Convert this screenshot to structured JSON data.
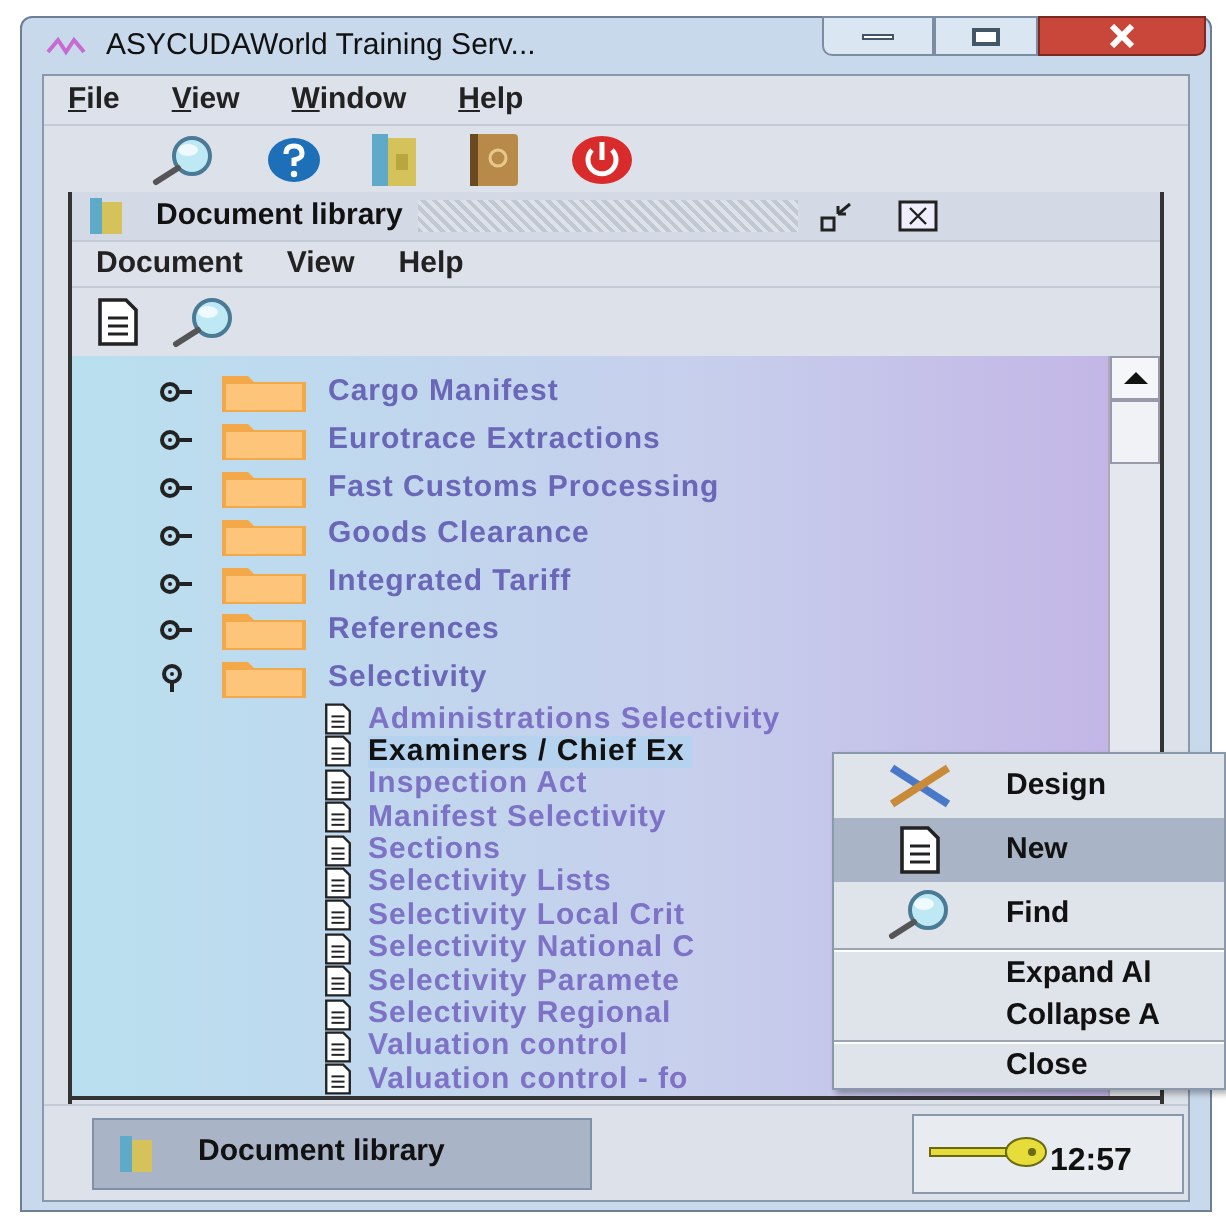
{
  "window": {
    "title": "ASYCUDAWorld Training Serv..."
  },
  "menu": [
    "File",
    "View",
    "Window",
    "Help"
  ],
  "toolbar": [
    {
      "kind": "search"
    },
    {
      "kind": "help"
    },
    {
      "kind": "book"
    },
    {
      "kind": "address"
    },
    {
      "kind": "power"
    }
  ],
  "internal_frame": {
    "title": "Document library",
    "menu": [
      "Document",
      "View",
      "Help"
    ],
    "toolbar": [
      {
        "kind": "document"
      },
      {
        "kind": "search"
      }
    ]
  },
  "tree": {
    "items": [
      {
        "label": "Cargo Manifest",
        "expanded": false
      },
      {
        "label": "Eurotrace Extractions",
        "expanded": false
      },
      {
        "label": "Fast Customs Processing",
        "expanded": false
      },
      {
        "label": "Goods Clearance",
        "expanded": false
      },
      {
        "label": "Integrated Tariff",
        "expanded": false
      },
      {
        "label": "References",
        "expanded": false
      },
      {
        "label": "Selectivity",
        "expanded": true,
        "children": [
          {
            "label": "Administrations Selectivity",
            "selected": false
          },
          {
            "label": "Examiners / Chief Ex",
            "selected": true
          },
          {
            "label": "Inspection Act",
            "selected": false
          },
          {
            "label": "Manifest Selectivity",
            "selected": false
          },
          {
            "label": "Sections",
            "selected": false
          },
          {
            "label": "Selectivity Lists",
            "selected": false
          },
          {
            "label": "Selectivity Local Crit",
            "selected": false
          },
          {
            "label": "Selectivity National C",
            "selected": false
          },
          {
            "label": "Selectivity Paramete",
            "selected": false
          },
          {
            "label": "Selectivity Regional",
            "selected": false
          },
          {
            "label": "Valuation control",
            "selected": false
          },
          {
            "label": "Valuation control - fo",
            "selected": false
          }
        ]
      }
    ]
  },
  "context_menu": [
    {
      "kind": "design",
      "label": "Design",
      "selected": false
    },
    {
      "kind": "document",
      "label": "New",
      "selected": true
    },
    {
      "kind": "search",
      "label": "Find",
      "selected": false
    },
    {
      "kind": "separator"
    },
    {
      "kind": "plain",
      "label": "Expand Al",
      "selected": false
    },
    {
      "kind": "plain",
      "label": "Collapse A",
      "selected": false
    },
    {
      "kind": "separator"
    },
    {
      "kind": "plain",
      "label": "Close",
      "selected": false
    }
  ],
  "status_bar": {
    "task": "Document library",
    "clock": "12:57"
  }
}
